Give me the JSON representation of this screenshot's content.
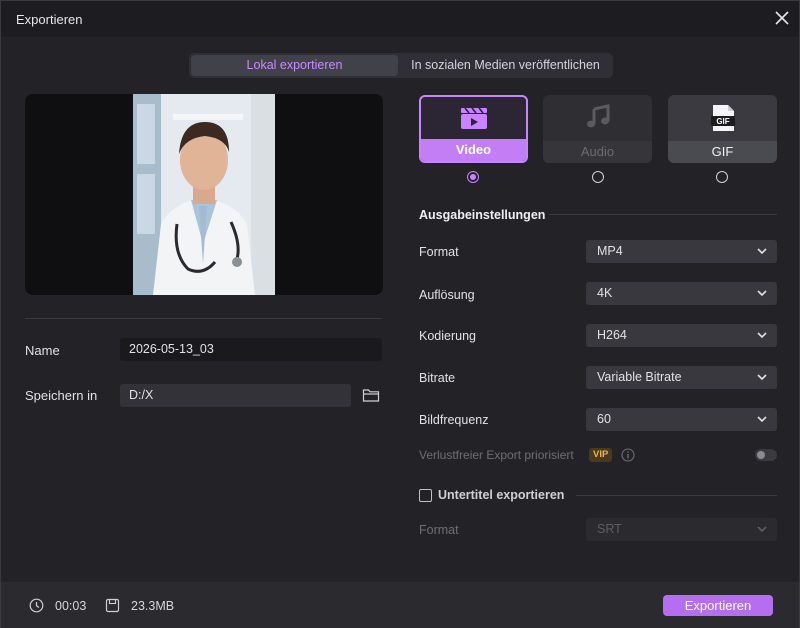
{
  "window": {
    "title": "Exportieren"
  },
  "tabs": [
    {
      "label": "Lokal exportieren"
    },
    {
      "label": "In sozialen Medien veröffentlichen"
    }
  ],
  "file": {
    "name_label": "Name",
    "name_value": "2026-05-13_03",
    "save_label": "Speichern in",
    "save_value": "D:/X"
  },
  "types": [
    {
      "label": "Video",
      "icon": "clapperboard-icon",
      "selected": true
    },
    {
      "label": "Audio",
      "icon": "music-note-icon",
      "disabled": true
    },
    {
      "label": "GIF",
      "icon": "gif-file-icon",
      "badge": "GIF"
    }
  ],
  "settings": {
    "title": "Ausgabeinstellungen",
    "rows": [
      {
        "label": "Format",
        "value": "MP4"
      },
      {
        "label": "Auflösung",
        "value": "4K"
      },
      {
        "label": "Kodierung",
        "value": "H264"
      },
      {
        "label": "Bitrate",
        "value": "Variable Bitrate"
      },
      {
        "label": "Bildfrequenz",
        "value": "60"
      }
    ],
    "lossless_label": "Verlustfreier Export priorisiert",
    "vip_badge": "VIP"
  },
  "subtitles": {
    "label": "Untertitel exportieren",
    "format_label": "Format",
    "format_value": "SRT"
  },
  "footer": {
    "duration": "00:03",
    "size": "23.3MB",
    "export_label": "Exportieren"
  },
  "colors": {
    "accent": "#c37ef6",
    "background": "#232327",
    "footer": "#2a2a2f"
  }
}
